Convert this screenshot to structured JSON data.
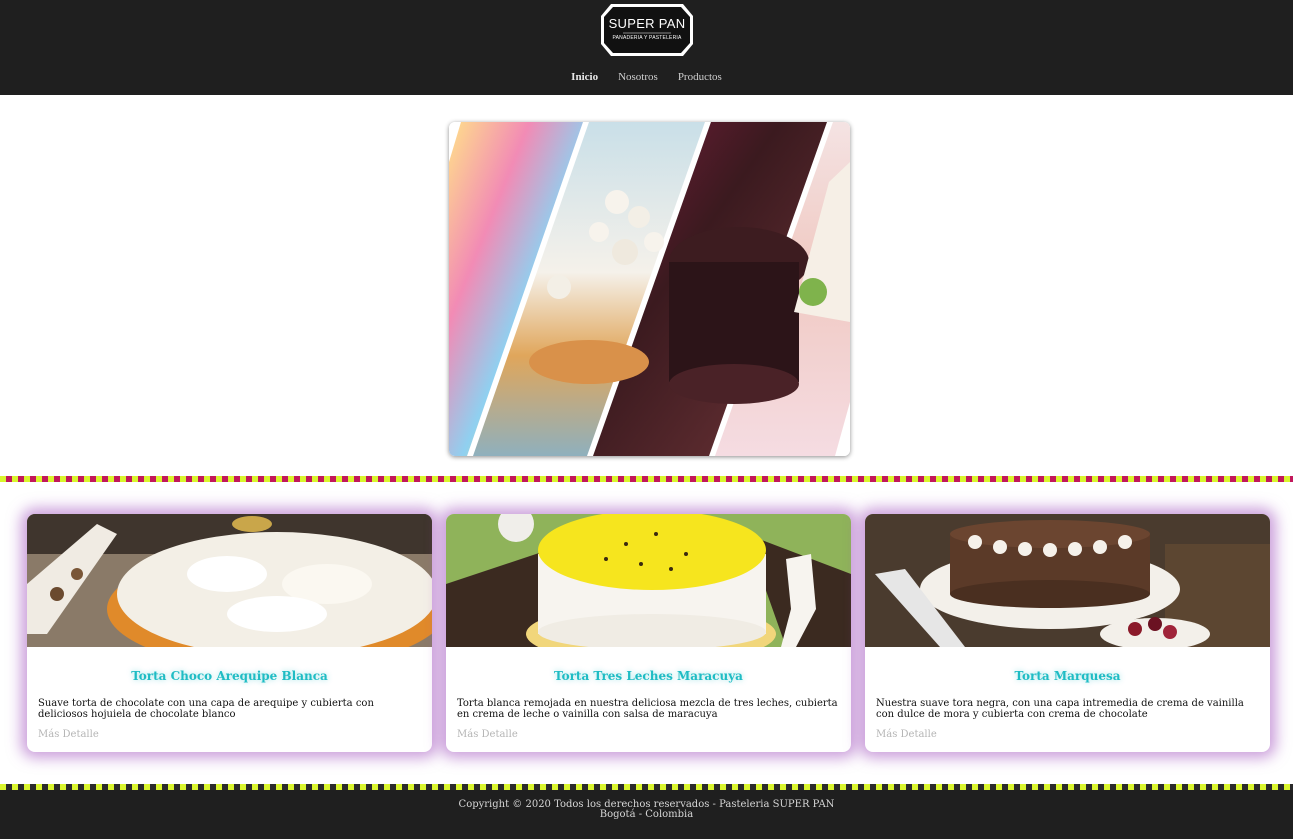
{
  "brand": {
    "name": "SUPER PAN",
    "tagline": "PANADERIA Y PASTELERIA"
  },
  "nav": {
    "items": [
      {
        "label": "Inicio",
        "active": true
      },
      {
        "label": "Nosotros",
        "active": false
      },
      {
        "label": "Productos",
        "active": false
      }
    ]
  },
  "colors": {
    "header_bg": "#1f1f1f",
    "title_accent": "#1fbcc4",
    "glow": "#a050be",
    "band_yellow": "#d9f52d",
    "band_magenta": "#c2185b"
  },
  "cards": [
    {
      "title": "Torta Choco Arequipe Blanca",
      "description": "Suave torta de chocolate con una capa de arequipe y cubierta con deliciosos hojuiela de chocolate blanco",
      "link": "Más Detalle"
    },
    {
      "title": "Torta Tres Leches Maracuya",
      "description": "Torta blanca remojada en nuestra deliciosa mezcla de tres leches, cubierta en crema de leche o vainilla con salsa de maracuya",
      "link": "Más Detalle"
    },
    {
      "title": "Torta Marquesa",
      "description": "Nuestra suave tora negra, con una capa intremedia de crema de vainilla con dulce de mora y cubierta con crema de chocolate",
      "link": "Más Detalle"
    }
  ],
  "footer": {
    "line1": "Copyright © 2020 Todos los derechos reservados - Pasteleria SUPER PAN",
    "line2": "Bogotá - Colombia"
  }
}
